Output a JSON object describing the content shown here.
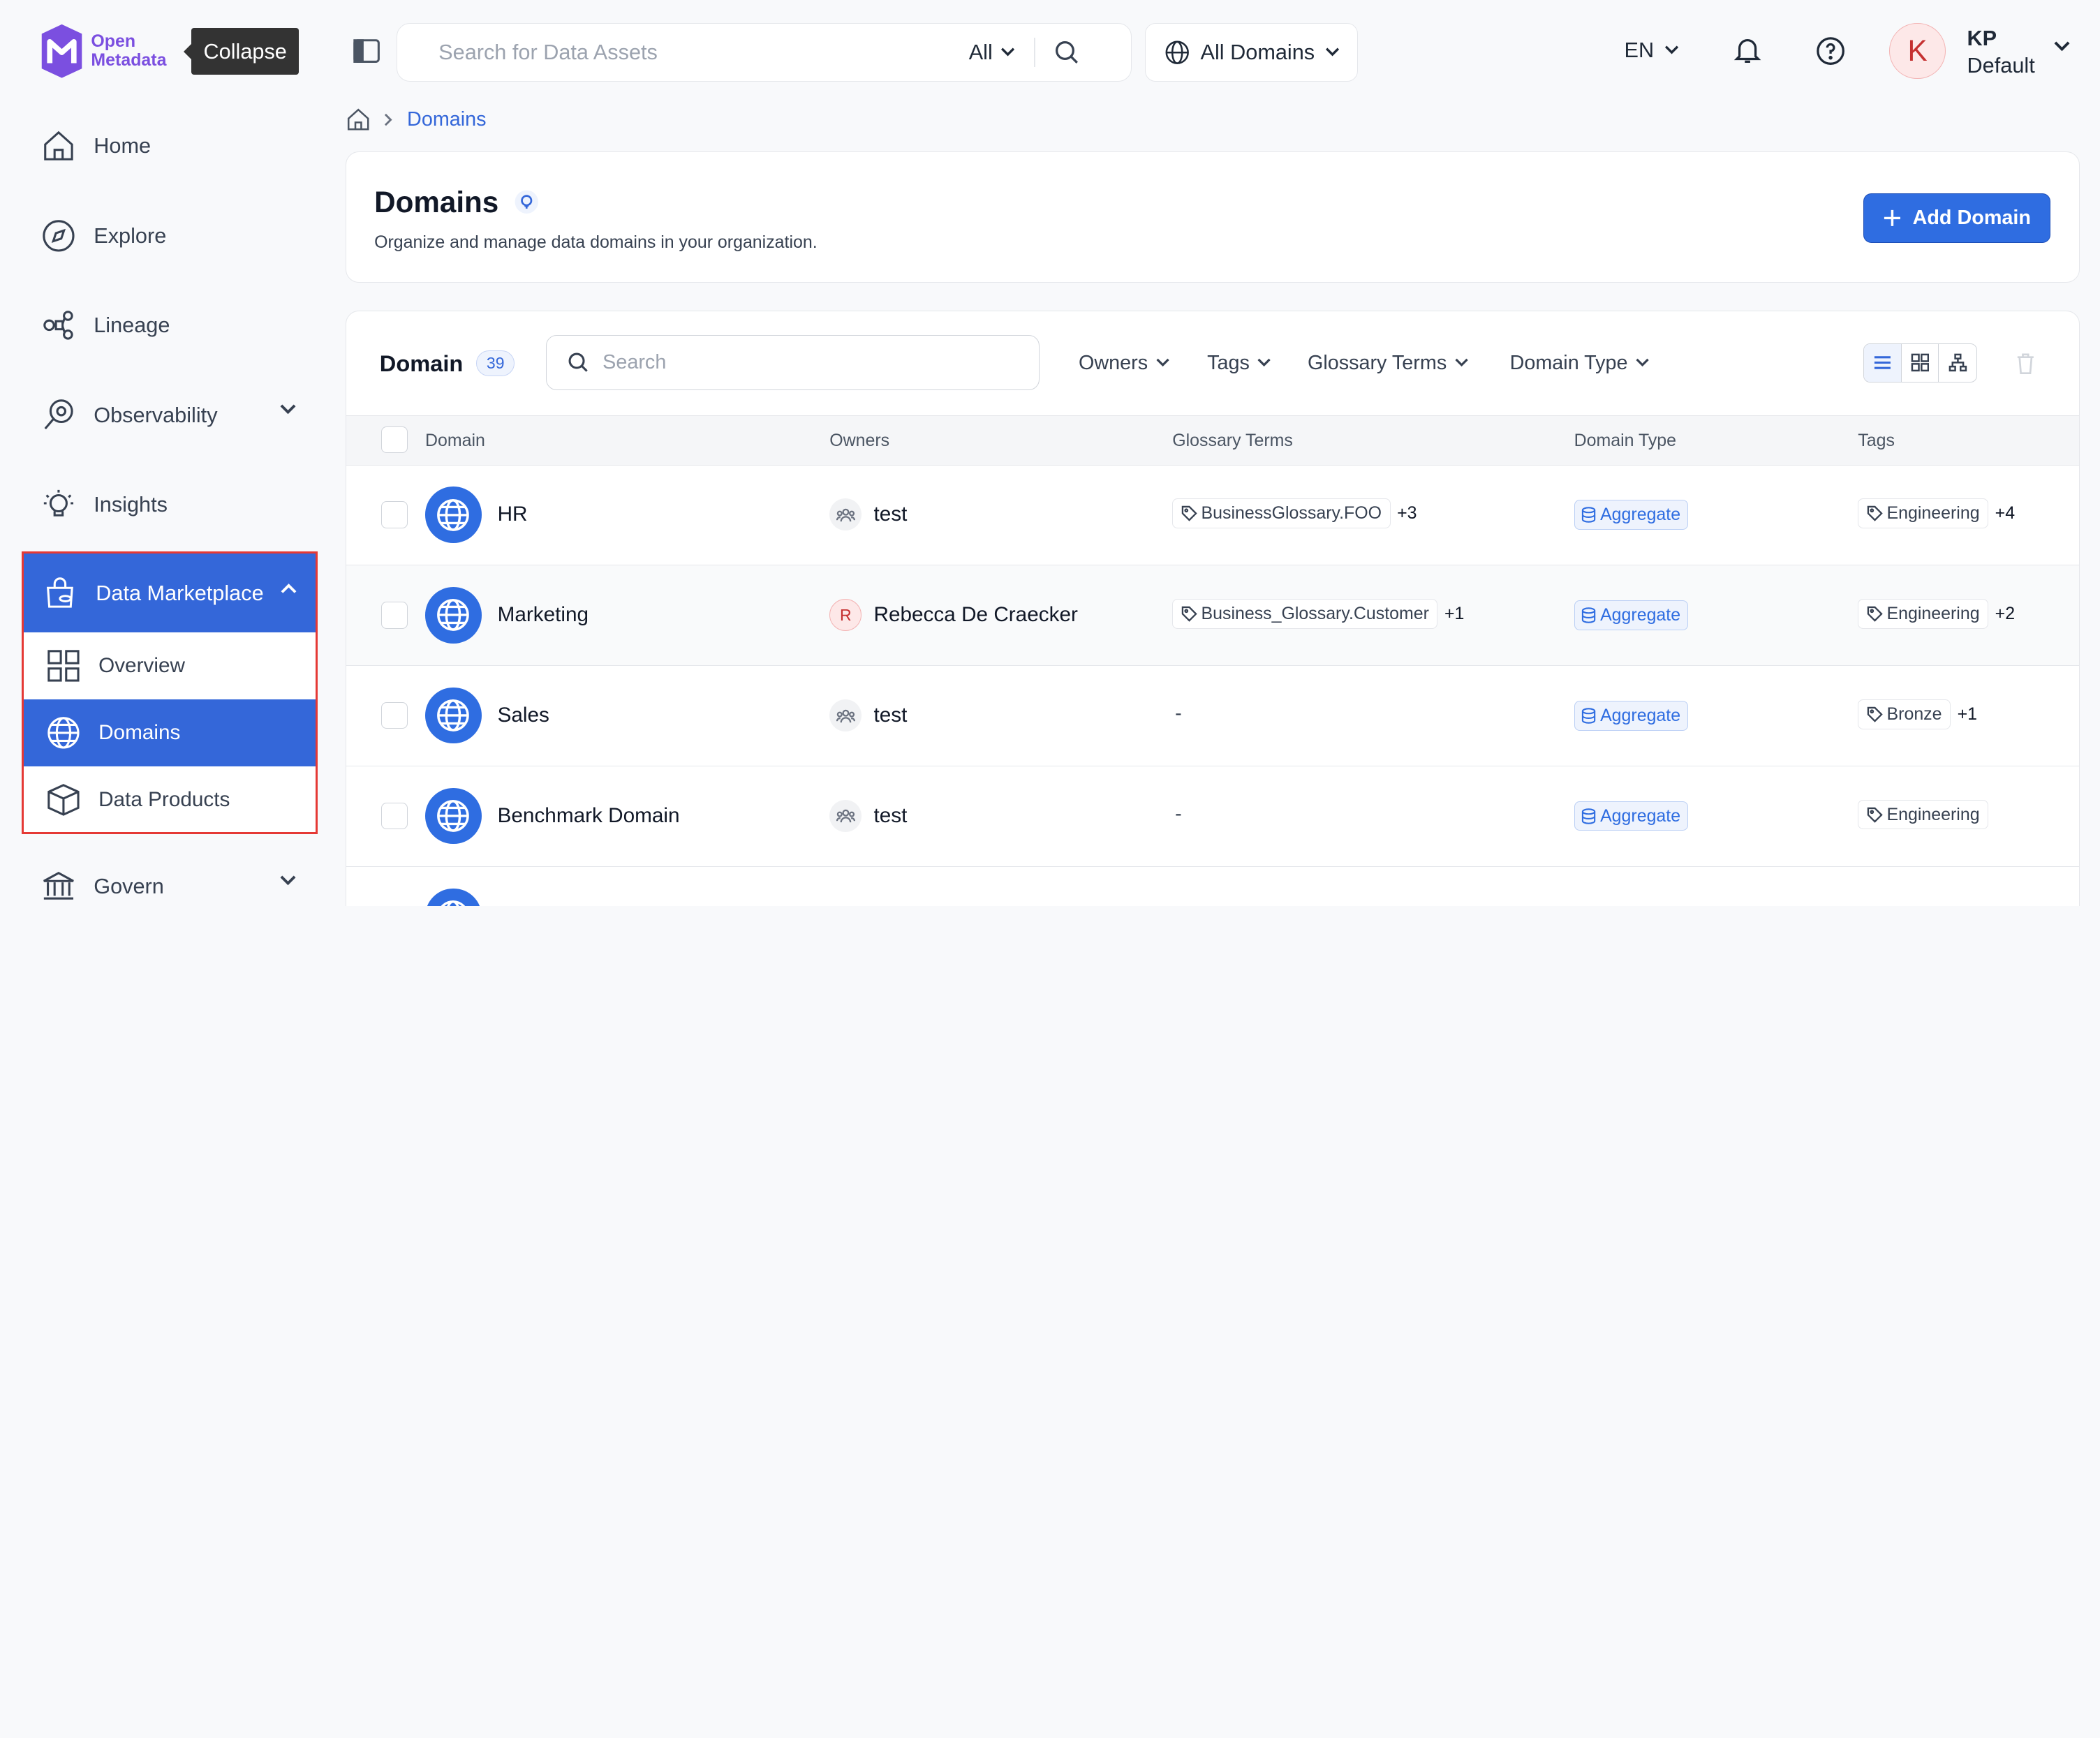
{
  "app": {
    "logo_line1": "Open",
    "logo_line2": "Metadata",
    "tooltip": "Collapse"
  },
  "sidebar": {
    "items": [
      {
        "label": "Home",
        "icon": "home-icon"
      },
      {
        "label": "Explore",
        "icon": "compass-icon"
      },
      {
        "label": "Lineage",
        "icon": "lineage-icon"
      },
      {
        "label": "Observability",
        "icon": "observability-icon"
      },
      {
        "label": "Insights",
        "icon": "bulb-icon"
      }
    ],
    "marketplace": {
      "label": "Data Marketplace",
      "sub": [
        {
          "label": "Overview",
          "icon": "grid-icon"
        },
        {
          "label": "Domains",
          "icon": "globe-icon"
        },
        {
          "label": "Data Products",
          "icon": "cube-icon"
        }
      ]
    },
    "govern": {
      "label": "Govern"
    }
  },
  "topbar": {
    "search_placeholder": "Search for Data Assets",
    "scope": "All",
    "domains": "All Domains",
    "lang": "EN",
    "avatar_letter": "K",
    "user_name": "KP",
    "user_role": "Default"
  },
  "breadcrumb": {
    "current": "Domains"
  },
  "header": {
    "title": "Domains",
    "subtitle": "Organize and manage data domains in your organization.",
    "add_label": "Add Domain"
  },
  "table": {
    "title": "Domain",
    "count": "39",
    "search_placeholder": "Search",
    "filters": [
      "Owners",
      "Tags",
      "Glossary Terms",
      "Domain Type"
    ],
    "columns": [
      "Domain",
      "Owners",
      "Glossary Terms",
      "Domain Type",
      "Tags"
    ],
    "rows": [
      {
        "name": "HR",
        "owner": "test",
        "owner_type": "team",
        "glossary": "BusinessGlossary.FOO",
        "glossary_more": "+3",
        "type": "Aggregate",
        "tag": "Engineering",
        "tag_more": "+4"
      },
      {
        "name": "Marketing",
        "owner": "Rebecca De Craecker",
        "owner_type": "user",
        "owner_initial": "R",
        "glossary": "Business_Glossary.Customer",
        "glossary_more": "+1",
        "type": "Aggregate",
        "tag": "Engineering",
        "tag_more": "+2"
      },
      {
        "name": "Sales",
        "owner": "test",
        "owner_type": "team",
        "glossary": "-",
        "glossary_more": "",
        "type": "Aggregate",
        "tag": "Bronze",
        "tag_more": "+1"
      },
      {
        "name": "Benchmark Domain",
        "owner": "test",
        "owner_type": "team",
        "glossary": "-",
        "glossary_more": "",
        "type": "Aggregate",
        "tag": "Engineering",
        "tag_more": ""
      }
    ]
  },
  "colors": {
    "accent": "#3467d9",
    "highlight_border": "#e53935",
    "brand": "#7b4fe0"
  }
}
